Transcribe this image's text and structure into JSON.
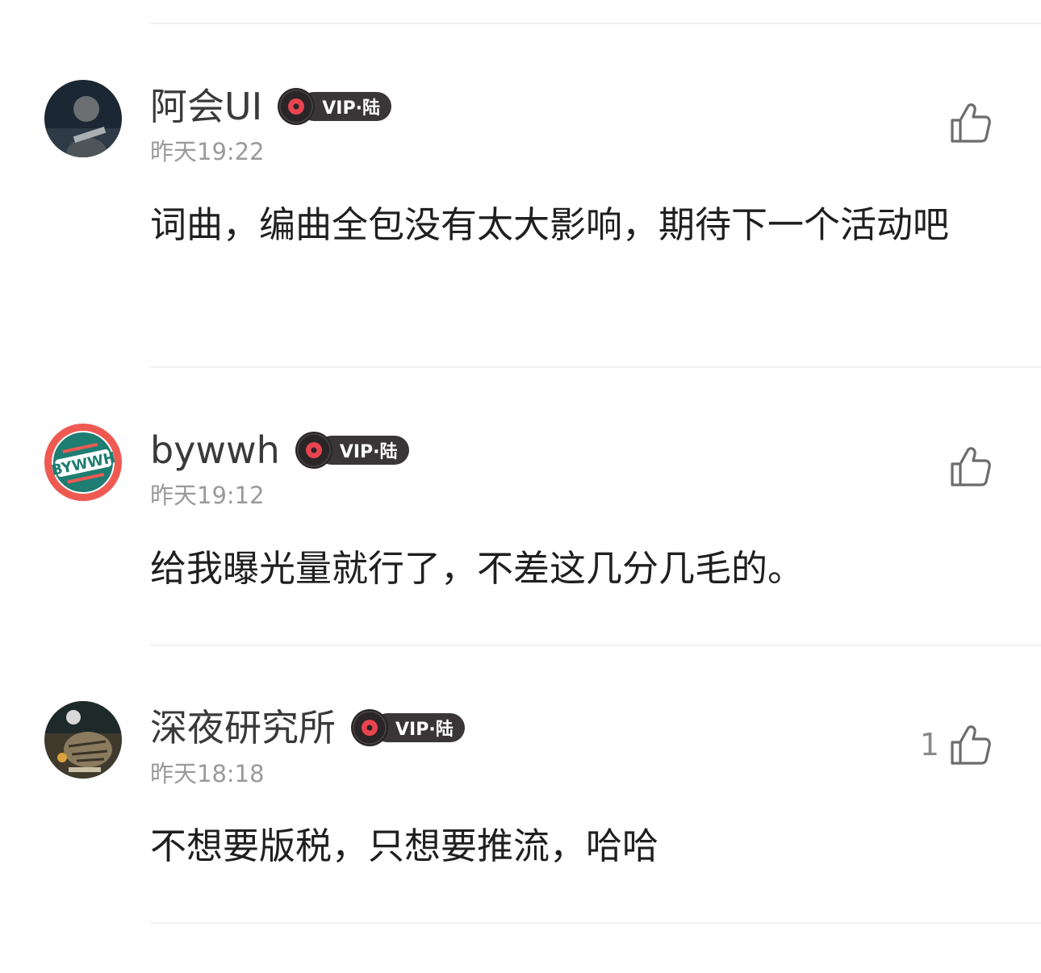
{
  "comments": [
    {
      "username": "阿会UI",
      "badge": "VIP·陆",
      "time": "昨天19:22",
      "content": "词曲，编曲全包没有太大影响，期待下一个活动吧",
      "likes": "",
      "avatar_icon": "user-avatar-person-dark"
    },
    {
      "username": "bywwh",
      "badge": "VIP·陆",
      "time": "昨天19:12",
      "content": "给我曝光量就行了，不差这几分几毛的。",
      "likes": "",
      "avatar_icon": "user-avatar-bywwh-logo"
    },
    {
      "username": "深夜研究所",
      "badge": "VIP·陆",
      "time": "昨天18:18",
      "content": "不想要版税，只想要推流，哈哈",
      "likes": "1",
      "avatar_icon": "user-avatar-cat"
    }
  ],
  "icons": {
    "like": "thumbs-up-outline-icon",
    "badge_disc": "vinyl-record-icon"
  },
  "colors": {
    "badge_bg": "#3a3536",
    "disc_accent": "#e8434f",
    "time": "#9a9a9a",
    "divider": "#f1f1f1"
  }
}
